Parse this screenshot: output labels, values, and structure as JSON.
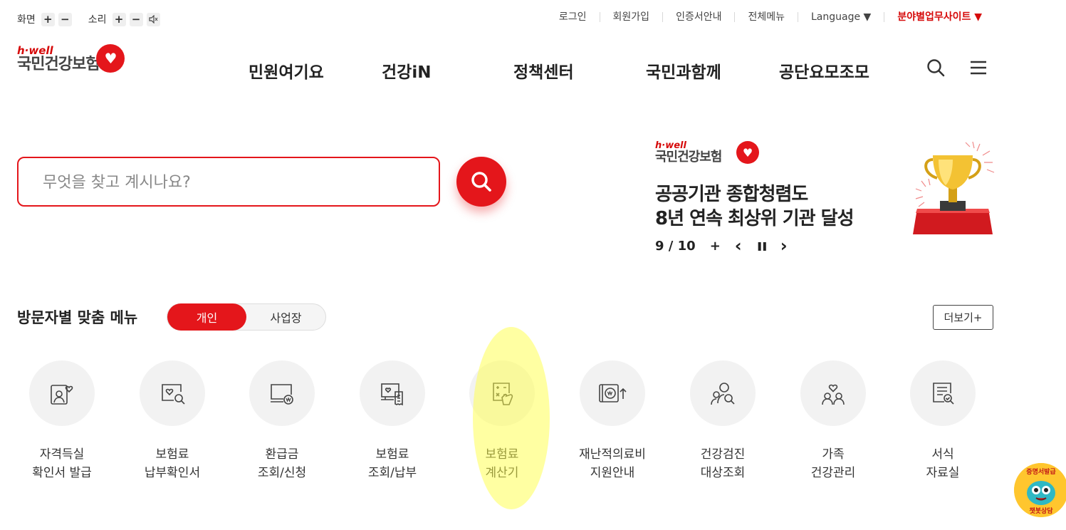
{
  "utility": {
    "screen_label": "화면",
    "sound_label": "소리",
    "plus": "+",
    "minus": "−",
    "links": [
      "로그인",
      "회원가입",
      "인증서안내",
      "전체메뉴",
      "Language ▼"
    ],
    "field_site": "분야별업무사이트 ▼"
  },
  "logo": {
    "tagline": "h·well",
    "name": "국민건강보험"
  },
  "gnb": [
    "민원여기요",
    "건강iN",
    "정책센터",
    "국민과함께",
    "공단요모조모"
  ],
  "search": {
    "placeholder": "무엇을 찾고 계시나요?"
  },
  "banner": {
    "logo_tagline": "h·well",
    "logo_name": "국민건강보험",
    "line1": "공공기관 종합청렴도",
    "line2": "8년 연속 최상위 기관 달성",
    "pager": "9 / 10",
    "plus": "+",
    "prev": "‹",
    "pause": "❚❚",
    "next": "›"
  },
  "visitor_menu": {
    "title": "방문자별 맞춤 메뉴",
    "tab_personal": "개인",
    "tab_business": "사업장",
    "more": "더보기+"
  },
  "quick_menus": [
    {
      "line1": "자격득실",
      "line2": "확인서 발급",
      "icon": "person-card-heart-icon"
    },
    {
      "line1": "보험료",
      "line2": "납부확인서",
      "icon": "doc-search-heart-icon"
    },
    {
      "line1": "환급금",
      "line2": "조회/신청",
      "icon": "monitor-won-icon"
    },
    {
      "line1": "보험료",
      "line2": "조회/납부",
      "icon": "screen-receipt-icon"
    },
    {
      "line1": "보험료",
      "line2": "계산기",
      "icon": "calculator-hand-icon"
    },
    {
      "line1": "재난적의료비",
      "line2": "지원안내",
      "icon": "won-arrow-up-icon"
    },
    {
      "line1": "건강검진",
      "line2": "대상조회",
      "icon": "people-search-icon"
    },
    {
      "line1": "가족",
      "line2": "건강관리",
      "icon": "family-heart-icon"
    },
    {
      "line1": "서식",
      "line2": "자료실",
      "icon": "document-search-icon"
    }
  ],
  "chatbot": {
    "top": "증명서발급",
    "bottom": "챗봇상담"
  },
  "colors": {
    "brand_red": "#e4161b",
    "highlight": "#ffff46"
  }
}
